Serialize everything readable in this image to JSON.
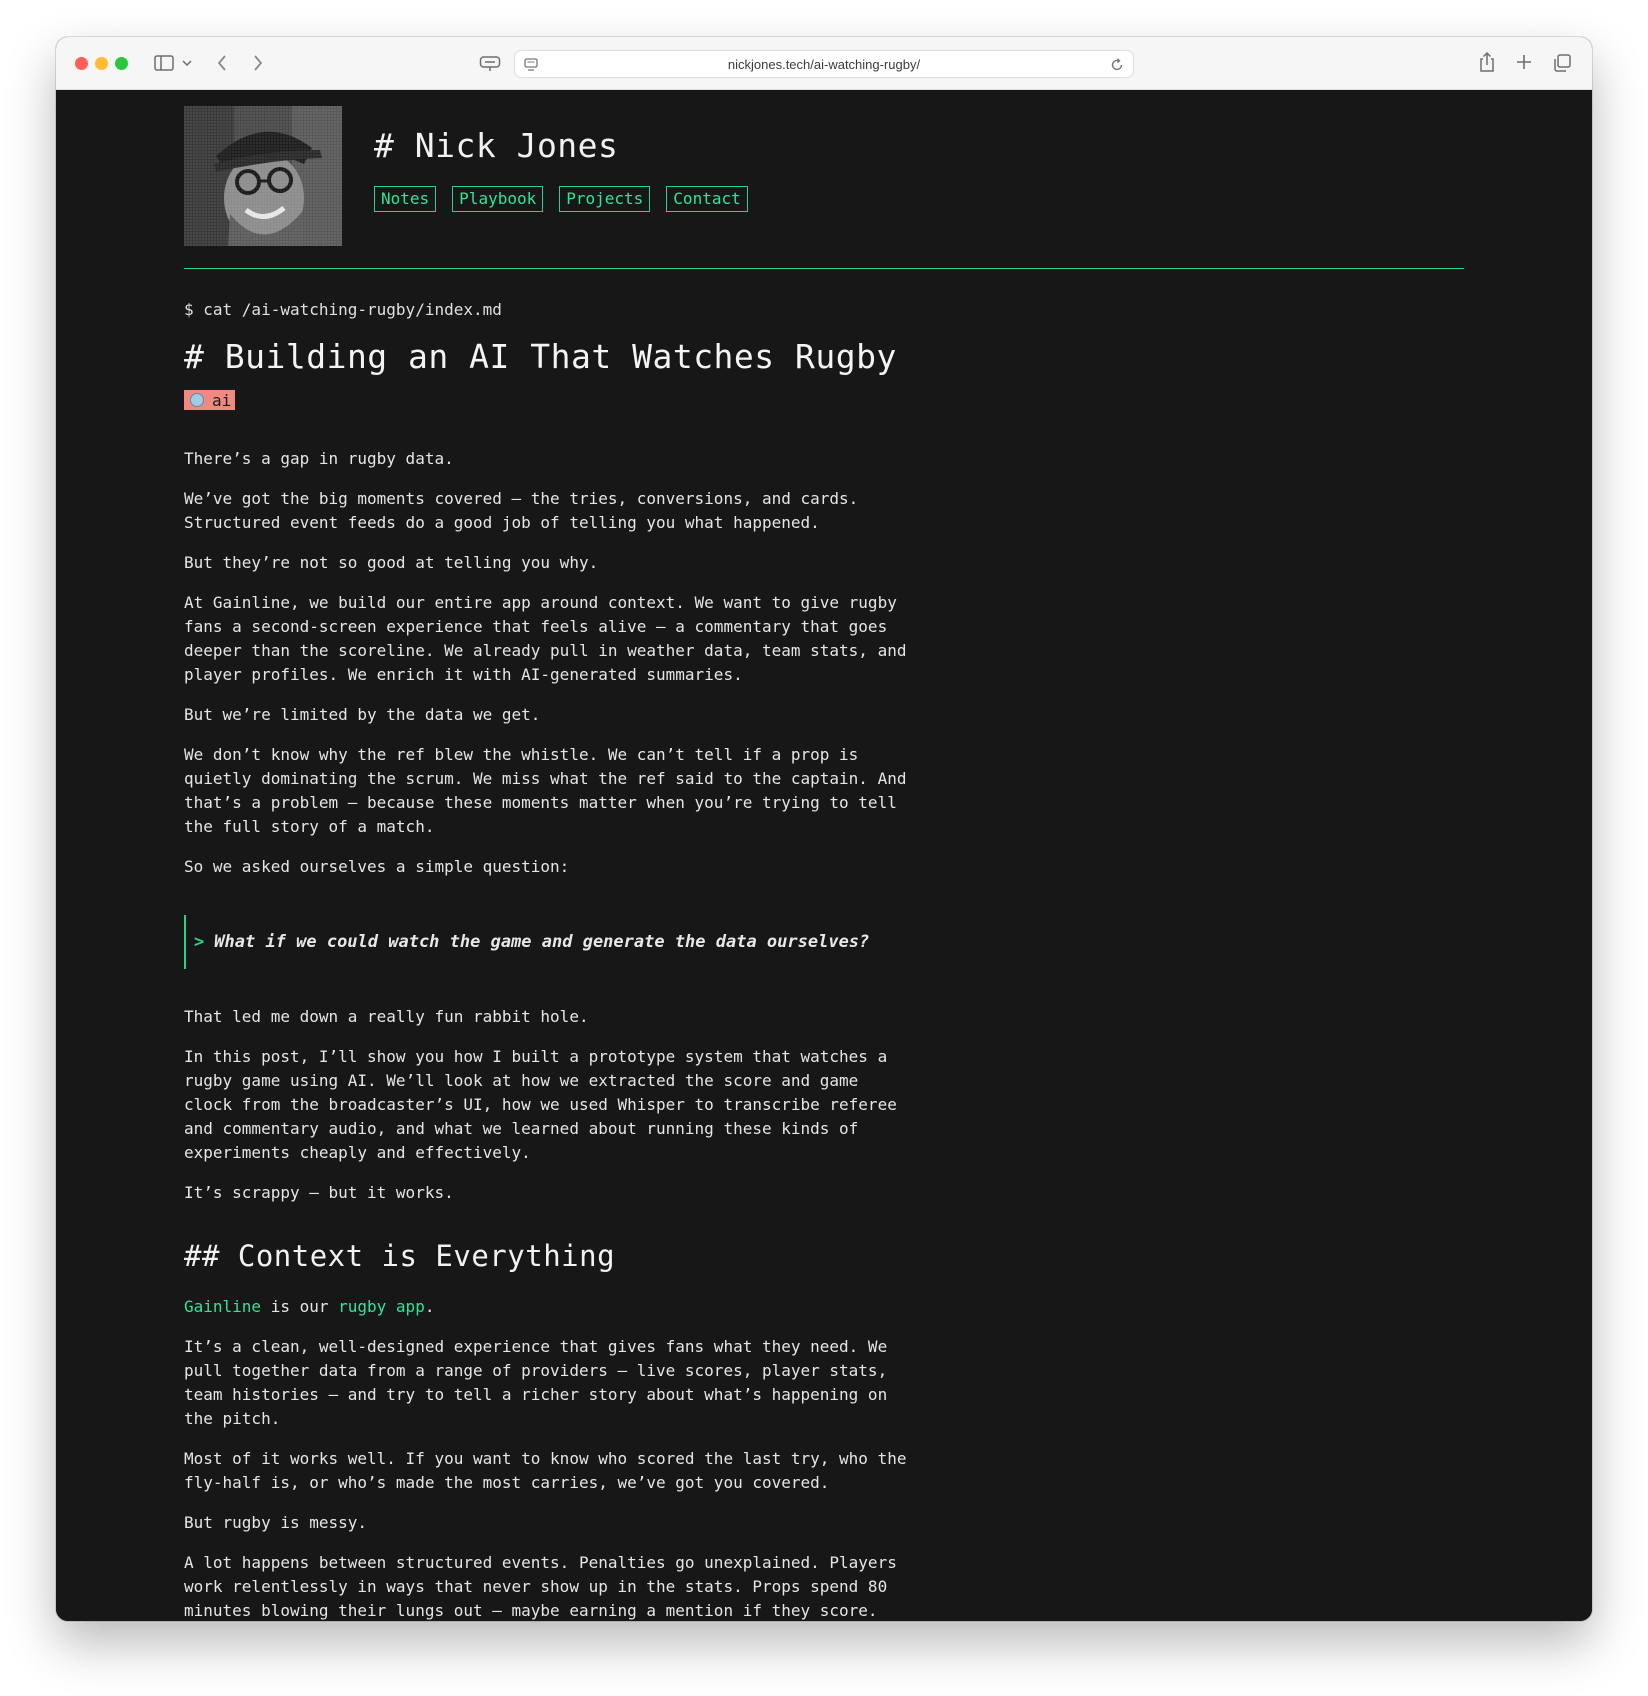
{
  "browser": {
    "url": "nickjones.tech/ai-watching-rugby/"
  },
  "site": {
    "title": "# Nick Jones",
    "nav": [
      "Notes",
      "Playbook",
      "Projects",
      "Contact"
    ]
  },
  "article": {
    "command": "$ cat /ai-watching-rugby/index.md",
    "title": "# Building an AI That Watches Rugby",
    "tag": "ai",
    "paragraphs_intro": [
      "There’s a gap in rugby data.",
      "We’ve got the big moments covered — the tries, conversions, and cards.\nStructured event feeds do a good job of telling you what happened.",
      "But they’re not so good at telling you why.",
      "At Gainline, we build our entire app around context. We want to give rugby\nfans a second-screen experience that feels alive — a commentary that goes\ndeeper than the scoreline. We already pull in weather data, team stats, and\nplayer profiles. We enrich it with AI-generated summaries.",
      "But we’re limited by the data we get.",
      "We don’t know why the ref blew the whistle. We can’t tell if a prop is\nquietly dominating the scrum. We miss what the ref said to the captain. And\nthat’s a problem — because these moments matter when you’re trying to tell\nthe full story of a match.",
      "So we asked ourselves a simple question:"
    ],
    "quote_marker": ">",
    "quote": "What if we could watch the game and generate the data ourselves?",
    "paragraphs_after_quote": [
      "That led me down a really fun rabbit hole.",
      "In this post, I’ll show you how I built a prototype system that watches a\nrugby game using AI. We’ll look at how we extracted the score and game\nclock from the broadcaster’s UI, how we used Whisper to transcribe referee\nand commentary audio, and what we learned about running these kinds of\nexperiments cheaply and effectively.",
      "It’s scrappy — but it works."
    ],
    "section_heading": "## Context is Everything",
    "section_intro": {
      "link1": "Gainline",
      "text1": " is our ",
      "link2": "rugby app",
      "text2": "."
    },
    "section_paragraphs": [
      "It’s a clean, well-designed experience that gives fans what they need. We\npull together data from a range of providers — live scores, player stats,\nteam histories — and try to tell a richer story about what’s happening on\nthe pitch.",
      "Most of it works well. If you want to know who scored the last try, who the\nfly-half is, or who’s made the most carries, we’ve got you covered.",
      "But rugby is messy.",
      "A lot happens between structured events. Penalties go unexplained. Players\nwork relentlessly in ways that never show up in the stats. Props spend 80\nminutes blowing their lungs out — maybe earning a mention if they score."
    ]
  },
  "colors": {
    "background": "#171717",
    "accent": "#28d28a",
    "tag_background": "#f08a80"
  }
}
